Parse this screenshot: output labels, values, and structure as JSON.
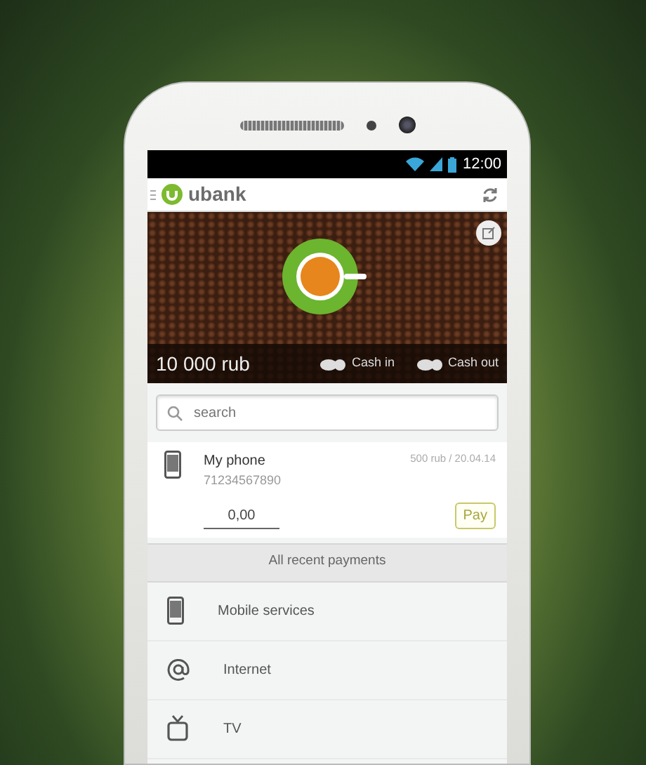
{
  "status_bar": {
    "time": "12:00"
  },
  "app_bar": {
    "logo": "ubank"
  },
  "balance": {
    "amount": "10 000 rub",
    "actions": [
      "Cash in",
      "Cash out"
    ]
  },
  "search": {
    "placeholder": "search"
  },
  "payment": {
    "name": "My phone",
    "number": "71234567890",
    "last": "500 rub / 20.04.14",
    "amount": "0,00",
    "button": "Pay"
  },
  "recent_link": "All recent payments",
  "categories": [
    {
      "kind": "mobile",
      "label": "Mobile services"
    },
    {
      "kind": "internet",
      "label": "Internet"
    },
    {
      "kind": "tv",
      "label": "TV"
    }
  ]
}
